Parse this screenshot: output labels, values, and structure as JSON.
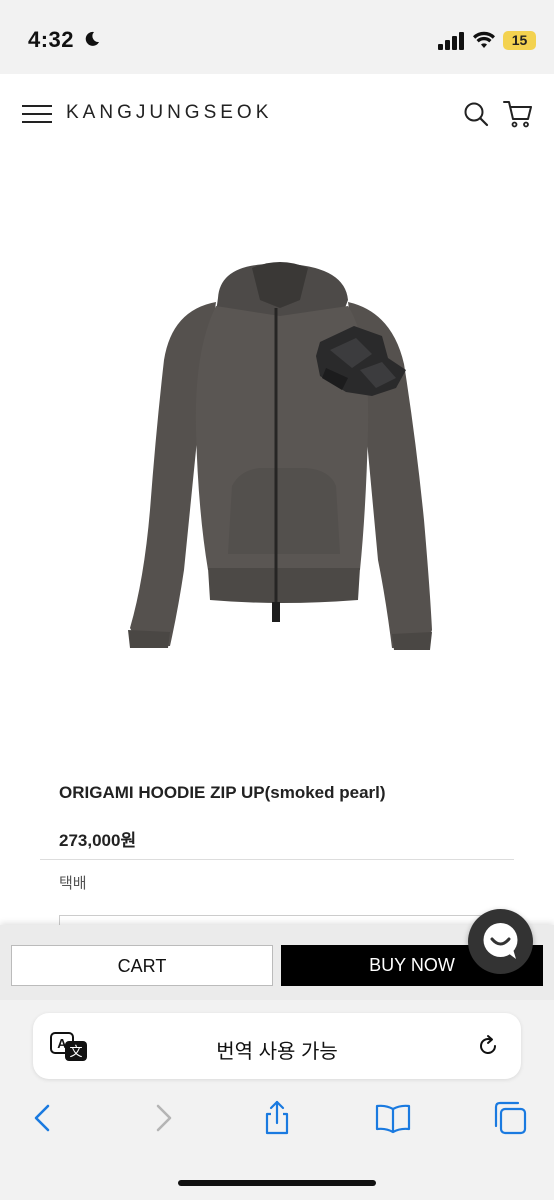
{
  "status_bar": {
    "time": "4:32",
    "battery_level": "15",
    "icons": [
      "moon-icon",
      "signal-icon",
      "wifi-icon",
      "battery-icon"
    ],
    "battery_color": "#f3d250"
  },
  "header": {
    "brand": "KANGJUNGSEOK",
    "icons": [
      "menu-icon",
      "search-icon",
      "cart-icon"
    ]
  },
  "product": {
    "image": "hoodie-image",
    "name": "ORIGAMI HOODIE ZIP UP(smoked pearl)",
    "price": "273,000원",
    "shipping": "택배"
  },
  "purchase_bar": {
    "cart_label": "CART",
    "buy_label": "BUY NOW",
    "chat_icon": "chat-icon"
  },
  "safari": {
    "translate_text": "번역 사용 가능",
    "icons": [
      "translate-icon",
      "reload-icon",
      "back-icon",
      "forward-icon",
      "share-icon",
      "bookmarks-icon",
      "tabs-icon"
    ],
    "accent": "#1a7ae0"
  }
}
